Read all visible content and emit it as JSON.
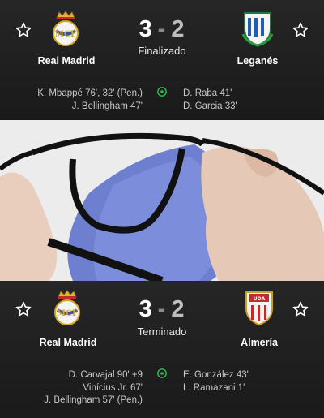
{
  "match1": {
    "home_team": "Real Madrid",
    "away_team": "Leganés",
    "home_score": "3",
    "away_score": "2",
    "separator": "-",
    "status": "Finalizado",
    "home_scorers": [
      "K. Mbappé 76', 32' (Pen.)",
      "J. Bellingham 47'"
    ],
    "away_scorers": [
      "D. Raba 41'",
      "D. Garcia 33'"
    ]
  },
  "match2": {
    "home_team": "Real Madrid",
    "away_team": "Almería",
    "home_score": "3",
    "away_score": "2",
    "separator": "-",
    "status": "Terminado",
    "home_scorers": [
      "D. Carvajal 90' +9",
      "Vinícius Jr. 67'",
      "J. Bellingham 57' (Pen.)"
    ],
    "away_scorers": [
      "E. González 43'",
      "L. Ramazani 1'"
    ]
  },
  "colors": {
    "background": "#1c1c1c",
    "goal_icon": "#2fbf4f",
    "text_secondary": "#c9c9c9"
  },
  "icons": {
    "favorite": "star-outline-icon",
    "goal": "football-icon"
  }
}
